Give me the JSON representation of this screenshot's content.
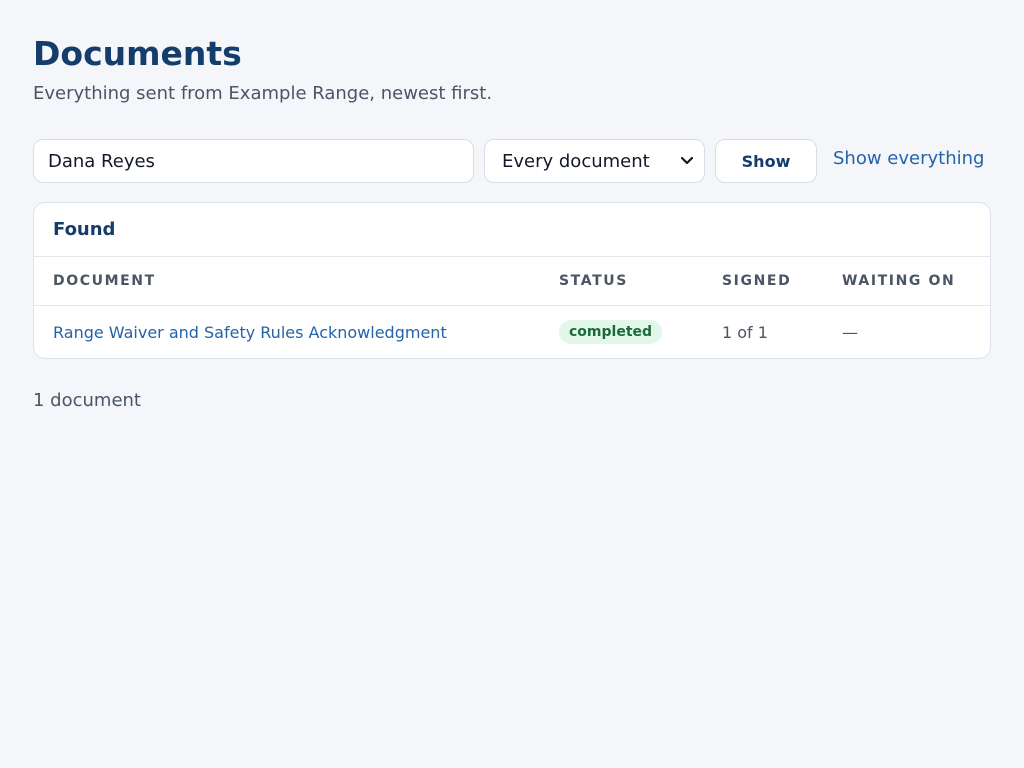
{
  "header": {
    "title": "Documents",
    "subtitle": "Everything sent from Example Range, newest first."
  },
  "filters": {
    "search_value": "Dana Reyes",
    "select_value": "Every document",
    "show_label": "Show",
    "show_all_label": "Show everything"
  },
  "results": {
    "heading": "Found",
    "columns": [
      "Document",
      "Status",
      "Signed",
      "Waiting on"
    ],
    "rows": [
      {
        "document": "Range Waiver and Safety Rules Acknowledgment",
        "status": "completed",
        "signed": "1 of 1",
        "waiting_on": "—"
      }
    ],
    "count": "1 document"
  },
  "colors": {
    "accent": "#143d6b",
    "link": "#2563a8",
    "status_completed_bg": "#e3f6ea",
    "status_completed_text": "#1a6b3a",
    "background": "#f4f6fa"
  },
  "icons": {
    "select": "chevron-down-icon"
  }
}
